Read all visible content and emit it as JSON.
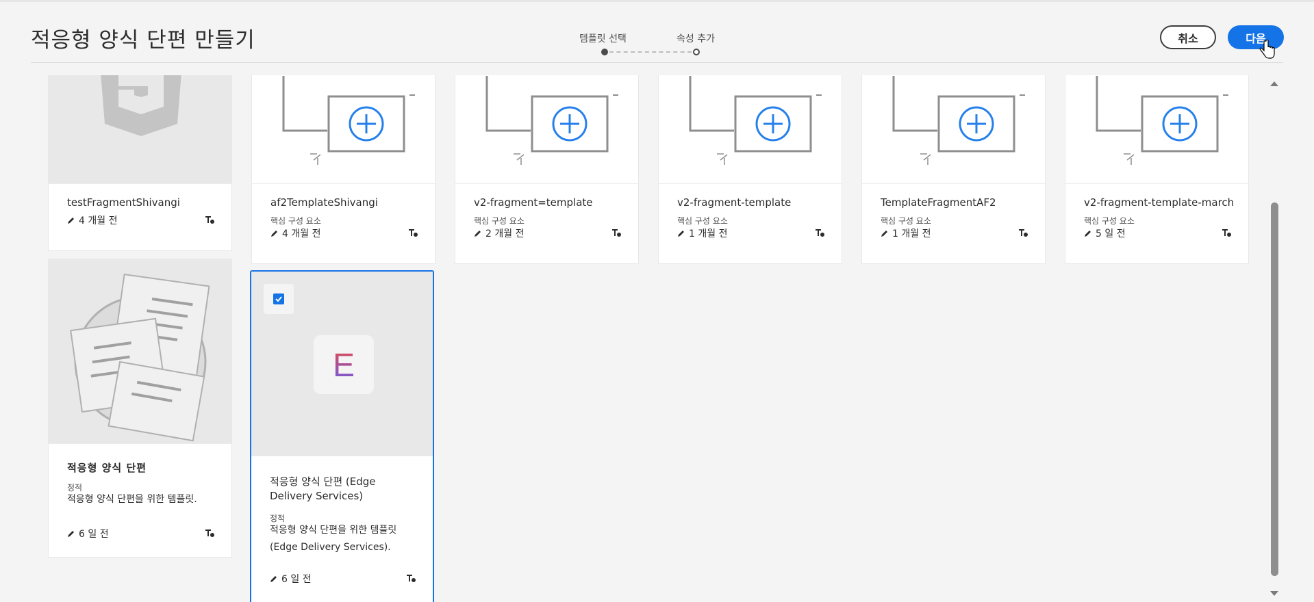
{
  "header": {
    "title": "적응형 양식 단편 만들기",
    "steps": [
      "템플릿 선택",
      "속성 추가"
    ],
    "cancel_label": "취소",
    "next_label": "다음"
  },
  "colors": {
    "accent": "#1473e6",
    "icon_blue": "#2680eb"
  },
  "cards": [
    {
      "name": "testFragmentShivangi",
      "sub": "",
      "modified": "4 개월 전",
      "icon": "html5-icon"
    },
    {
      "name": "af2TemplateShivangi",
      "sub": "핵심 구성 요소",
      "modified": "4 개월 전",
      "icon": "add-template-icon"
    },
    {
      "name": "v2-fragment=template",
      "sub": "핵심 구성 요소",
      "modified": "2 개월 전",
      "icon": "add-template-icon"
    },
    {
      "name": "v2-fragment-template",
      "sub": "핵심 구성 요소",
      "modified": "1 개월 전",
      "icon": "add-template-icon"
    },
    {
      "name": "TemplateFragmentAF2",
      "sub": "핵심 구성 요소",
      "modified": "1 개월 전",
      "icon": "add-template-icon"
    },
    {
      "name": "v2-fragment-template-march",
      "sub": "핵심 구성 요소",
      "modified": "5 일 전",
      "icon": "add-template-icon"
    },
    {
      "name": "적응형 양식 단편",
      "sub": "정적",
      "desc": "적응형 양식 단편을 위한 템플릿.",
      "modified": "6 일 전",
      "icon": "documents-icon"
    },
    {
      "name_l1": "적응형 양식 단편 (Edge",
      "name_l2": "Delivery Services)",
      "sub": "정적",
      "desc_l1": "적응형 양식 단편을 위한 템플릿",
      "desc_l2": "(Edge Delivery Services).",
      "modified": "6 일 전",
      "icon": "edge-e-icon",
      "selected": true,
      "logo_letter": "E"
    }
  ]
}
